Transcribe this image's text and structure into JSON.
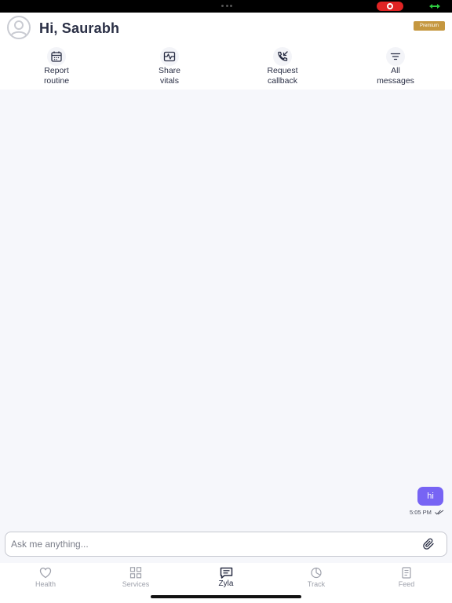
{
  "header": {
    "greeting": "Hi, Saurabh",
    "badge": "Premium"
  },
  "actions": [
    {
      "label": "Report\nroutine",
      "icon": "calendar-icon"
    },
    {
      "label": "Share\nvitals",
      "icon": "vitals-icon"
    },
    {
      "label": "Request\ncallback",
      "icon": "phone-callback-icon"
    },
    {
      "label": "All\nmessages",
      "icon": "filter-icon"
    }
  ],
  "chat": {
    "messages": [
      {
        "text": "hi",
        "time": "5:05 PM",
        "status": "read"
      }
    ]
  },
  "composer": {
    "placeholder": "Ask me anything...",
    "value": ""
  },
  "tabs": [
    {
      "label": "Health",
      "icon": "heart-icon",
      "active": false
    },
    {
      "label": "Services",
      "icon": "grid-icon",
      "active": false
    },
    {
      "label": "Zyla",
      "icon": "chat-icon",
      "active": true
    },
    {
      "label": "Track",
      "icon": "pie-chart-icon",
      "active": false
    },
    {
      "label": "Feed",
      "icon": "document-icon",
      "active": false
    }
  ],
  "colors": {
    "accent": "#7764f4",
    "premium": "#c5973f",
    "text_dark": "#2a2f45",
    "tab_inactive": "#9ea1ab"
  }
}
